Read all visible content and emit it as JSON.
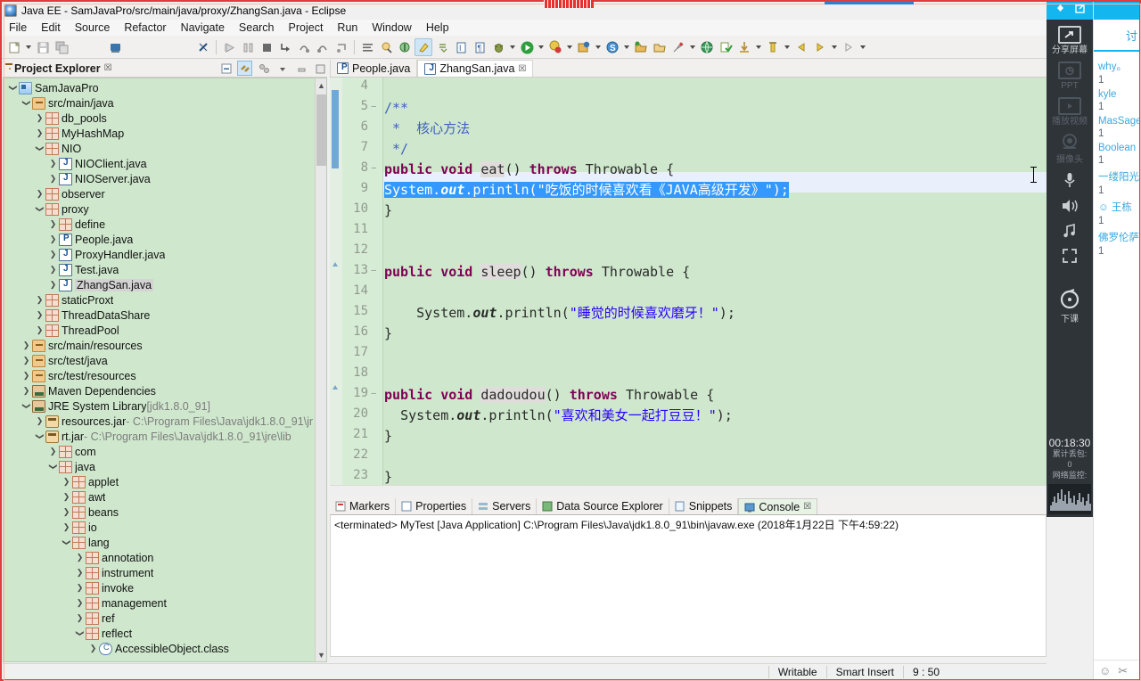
{
  "window": {
    "title": "Java EE - SamJavaPro/src/main/java/proxy/ZhangSan.java - Eclipse",
    "app_icon": "eclipse-icon"
  },
  "menubar": {
    "items": [
      "File",
      "Edit",
      "Source",
      "Refactor",
      "Navigate",
      "Search",
      "Project",
      "Run",
      "Window",
      "Help"
    ]
  },
  "toolbar": {
    "icons": [
      "new-icon",
      "save-icon",
      "save-all-icon",
      "print-icon",
      "link-break-icon",
      "resume-icon",
      "suspend-icon",
      "terminate-icon",
      "step-into-icon",
      "step-over-icon",
      "step-return-icon",
      "drop-to-frame-icon",
      "open-type-icon",
      "search-icon",
      "annotations-icon",
      "marker-icon",
      "next-annotation-icon",
      "prev-annotation-icon",
      "show-whitespace-icon",
      "pilcrow-icon",
      "debug-icon",
      "run-icon",
      "coverage-icon",
      "new-java-project-icon",
      "new-servlet-icon",
      "open-task-icon",
      "open-perspective-icon",
      "rocket-icon",
      "globe-icon",
      "validate-icon",
      "download-icon",
      "profile-icon",
      "back-icon",
      "forward-icon",
      "next-icon"
    ]
  },
  "project_explorer": {
    "title": "Project Explorer",
    "close_glyph": "☒",
    "header_icons": [
      "collapse-all-icon",
      "link-with-editor-icon",
      "view-menu-icon",
      "minimize-icon",
      "maximize-icon"
    ],
    "tree": [
      {
        "depth": 1,
        "arrow": "down",
        "icon": "project-icon",
        "label": "SamJavaPro",
        "sub": ""
      },
      {
        "depth": 2,
        "arrow": "down",
        "icon": "source-folder-icon",
        "label": "src/main/java",
        "sub": ""
      },
      {
        "depth": 3,
        "arrow": "right",
        "icon": "package-icon",
        "label": "db_pools",
        "sub": ""
      },
      {
        "depth": 3,
        "arrow": "right",
        "icon": "package-icon",
        "label": "MyHashMap",
        "sub": ""
      },
      {
        "depth": 3,
        "arrow": "down",
        "icon": "package-icon",
        "label": "NIO",
        "sub": ""
      },
      {
        "depth": 4,
        "arrow": "right",
        "icon": "java-file-icon",
        "label": "NIOClient.java",
        "sub": ""
      },
      {
        "depth": 4,
        "arrow": "right",
        "icon": "java-file-icon",
        "label": "NIOServer.java",
        "sub": ""
      },
      {
        "depth": 3,
        "arrow": "right",
        "icon": "package-icon",
        "label": "observer",
        "sub": ""
      },
      {
        "depth": 3,
        "arrow": "down",
        "icon": "package-icon",
        "label": "proxy",
        "sub": ""
      },
      {
        "depth": 4,
        "arrow": "right",
        "icon": "package-icon",
        "label": "define",
        "sub": ""
      },
      {
        "depth": 4,
        "arrow": "right",
        "icon": "java-interface-icon",
        "label": "People.java",
        "sub": ""
      },
      {
        "depth": 4,
        "arrow": "right",
        "icon": "java-file-icon",
        "label": "ProxyHandler.java",
        "sub": ""
      },
      {
        "depth": 4,
        "arrow": "right",
        "icon": "java-file-icon",
        "label": "Test.java",
        "sub": ""
      },
      {
        "depth": 4,
        "arrow": "right",
        "icon": "java-file-icon",
        "label": "ZhangSan.java",
        "sub": "",
        "selected": true
      },
      {
        "depth": 3,
        "arrow": "right",
        "icon": "package-icon",
        "label": "staticProxt",
        "sub": ""
      },
      {
        "depth": 3,
        "arrow": "right",
        "icon": "package-icon",
        "label": "ThreadDataShare",
        "sub": ""
      },
      {
        "depth": 3,
        "arrow": "right",
        "icon": "package-icon",
        "label": "ThreadPool",
        "sub": ""
      },
      {
        "depth": 2,
        "arrow": "right",
        "icon": "source-folder-icon",
        "label": "src/main/resources",
        "sub": ""
      },
      {
        "depth": 2,
        "arrow": "right",
        "icon": "source-folder-icon",
        "label": "src/test/java",
        "sub": ""
      },
      {
        "depth": 2,
        "arrow": "right",
        "icon": "source-folder-icon",
        "label": "src/test/resources",
        "sub": ""
      },
      {
        "depth": 2,
        "arrow": "right",
        "icon": "library-icon",
        "label": "Maven Dependencies",
        "sub": ""
      },
      {
        "depth": 2,
        "arrow": "down",
        "icon": "library-icon",
        "label": "JRE System Library",
        "sub": "[jdk1.8.0_91]"
      },
      {
        "depth": 3,
        "arrow": "right",
        "icon": "jar-icon",
        "label": "resources.jar",
        "sub": "- C:\\Program Files\\Java\\jdk1.8.0_91\\jr"
      },
      {
        "depth": 3,
        "arrow": "down",
        "icon": "jar-icon",
        "label": "rt.jar",
        "sub": "- C:\\Program Files\\Java\\jdk1.8.0_91\\jre\\lib"
      },
      {
        "depth": 4,
        "arrow": "right",
        "icon": "package-icon",
        "label": "com",
        "sub": ""
      },
      {
        "depth": 4,
        "arrow": "down",
        "icon": "package-icon",
        "label": "java",
        "sub": ""
      },
      {
        "depth": 5,
        "arrow": "right",
        "icon": "package-icon",
        "label": "applet",
        "sub": ""
      },
      {
        "depth": 5,
        "arrow": "right",
        "icon": "package-icon",
        "label": "awt",
        "sub": ""
      },
      {
        "depth": 5,
        "arrow": "right",
        "icon": "package-icon",
        "label": "beans",
        "sub": ""
      },
      {
        "depth": 5,
        "arrow": "right",
        "icon": "package-icon",
        "label": "io",
        "sub": ""
      },
      {
        "depth": 5,
        "arrow": "down",
        "icon": "package-icon",
        "label": "lang",
        "sub": ""
      },
      {
        "depth": 6,
        "arrow": "right",
        "icon": "package-icon",
        "label": "annotation",
        "sub": ""
      },
      {
        "depth": 6,
        "arrow": "right",
        "icon": "package-icon",
        "label": "instrument",
        "sub": ""
      },
      {
        "depth": 6,
        "arrow": "right",
        "icon": "package-icon",
        "label": "invoke",
        "sub": ""
      },
      {
        "depth": 6,
        "arrow": "right",
        "icon": "package-icon",
        "label": "management",
        "sub": ""
      },
      {
        "depth": 6,
        "arrow": "right",
        "icon": "package-icon",
        "label": "ref",
        "sub": ""
      },
      {
        "depth": 6,
        "arrow": "down",
        "icon": "package-icon",
        "label": "reflect",
        "sub": ""
      },
      {
        "depth": 7,
        "arrow": "right",
        "icon": "class-file-icon",
        "label": "AccessibleObject.class",
        "sub": ""
      }
    ]
  },
  "editor": {
    "tabs": [
      {
        "label": "People.java",
        "icon": "java-interface-icon",
        "active": false,
        "closable": false
      },
      {
        "label": "ZhangSan.java",
        "icon": "java-file-icon",
        "active": true,
        "closable": true,
        "close_glyph": "☒"
      }
    ],
    "lines": [
      {
        "num": "4",
        "fold": false,
        "marker": "",
        "text": ""
      },
      {
        "num": "5",
        "fold": true,
        "marker": "",
        "text": "    /**"
      },
      {
        "num": "6",
        "fold": false,
        "marker": "",
        "text": "     *  核心方法"
      },
      {
        "num": "7",
        "fold": false,
        "marker": "",
        "text": "     */"
      },
      {
        "num": "8",
        "fold": true,
        "marker": "tri",
        "text": "    public void eat() throws Throwable {"
      },
      {
        "num": "9",
        "fold": false,
        "marker": "",
        "text": "        System.out.println(\"吃饭的时候喜欢看《JAVA高级开发》\");",
        "highlighted": true,
        "selected": true
      },
      {
        "num": "10",
        "fold": false,
        "marker": "",
        "text": "    }"
      },
      {
        "num": "11",
        "fold": false,
        "marker": "",
        "text": ""
      },
      {
        "num": "12",
        "fold": false,
        "marker": "",
        "text": ""
      },
      {
        "num": "13",
        "fold": true,
        "marker": "tri",
        "text": "    public void sleep() throws Throwable {"
      },
      {
        "num": "14",
        "fold": false,
        "marker": "",
        "text": ""
      },
      {
        "num": "15",
        "fold": false,
        "marker": "",
        "text": "        System.out.println(\"睡觉的时候喜欢磨牙！\");"
      },
      {
        "num": "16",
        "fold": false,
        "marker": "",
        "text": "    }"
      },
      {
        "num": "17",
        "fold": false,
        "marker": "",
        "text": ""
      },
      {
        "num": "18",
        "fold": false,
        "marker": "",
        "text": ""
      },
      {
        "num": "19",
        "fold": true,
        "marker": "tri",
        "text": "    public void dadoudou() throws Throwable {"
      },
      {
        "num": "20",
        "fold": false,
        "marker": "",
        "text": "       System.out.println(\"喜欢和美女一起打豆豆！\");"
      },
      {
        "num": "21",
        "fold": false,
        "marker": "",
        "text": "    }"
      },
      {
        "num": "22",
        "fold": false,
        "marker": "",
        "text": ""
      },
      {
        "num": "23",
        "fold": false,
        "marker": "",
        "text": "}"
      }
    ],
    "tokens": {
      "kw_public": "public",
      "kw_void": "void",
      "kw_throws": "throws",
      "type_throwable": "Throwable",
      "m_eat": "eat",
      "m_sleep": "sleep",
      "m_dadoudou": "dadoudou",
      "sysout": "System.",
      "out": "out",
      "println": ".println(",
      "str_eat": "\"吃饭的时候喜欢看《JAVA高级开发》\"",
      "str_sleep": "\"睡觉的时候喜欢磨牙！\"",
      "str_dadoudou": "\"喜欢和美女一起打豆豆！\"",
      "comment_open": "/**",
      "comment_mid": " *  核心方法",
      "comment_close": " */",
      "brace_close": "}"
    }
  },
  "bottom_panel": {
    "tabs": [
      {
        "label": "Markers",
        "icon": "markers-icon",
        "active": false
      },
      {
        "label": "Properties",
        "icon": "properties-icon",
        "active": false
      },
      {
        "label": "Servers",
        "icon": "servers-icon",
        "active": false
      },
      {
        "label": "Data Source Explorer",
        "icon": "data-source-icon",
        "active": false
      },
      {
        "label": "Snippets",
        "icon": "snippets-icon",
        "active": false
      },
      {
        "label": "Console",
        "icon": "console-icon",
        "active": true,
        "close_glyph": "☒"
      }
    ],
    "console_line": "<terminated> MyTest [Java Application] C:\\Program Files\\Java\\jdk1.8.0_91\\bin\\javaw.exe (2018年1月22日 下午4:59:22)"
  },
  "statusbar": {
    "writable": "Writable",
    "insert_mode": "Smart Insert",
    "cursor_position": "9 : 50"
  },
  "dock": {
    "top_icons": [
      "pin-icon",
      "popout-icon"
    ],
    "buttons": [
      {
        "label": "分享屏幕",
        "icon": "share-screen-icon",
        "dim": false,
        "boxed": true
      },
      {
        "label": "PPT",
        "icon": "ppt-icon",
        "dim": true,
        "boxed": true
      },
      {
        "label": "播放视频",
        "icon": "play-video-icon",
        "dim": true,
        "boxed": true
      },
      {
        "label": "摄像头",
        "icon": "camera-icon",
        "dim": true,
        "boxed": false
      },
      {
        "label": "",
        "icon": "microphone-icon",
        "dim": false,
        "boxed": false
      },
      {
        "label": "",
        "icon": "speaker-icon",
        "dim": false,
        "boxed": false
      },
      {
        "label": "",
        "icon": "music-icon",
        "dim": false,
        "boxed": false
      },
      {
        "label": "",
        "icon": "fullscreen-icon",
        "dim": false,
        "boxed": false
      },
      {
        "label": "下课",
        "icon": "end-class-icon",
        "dim": false,
        "boxed": false
      }
    ],
    "timer": "00:18:30",
    "packet_loss_label": "累计丢包:",
    "packet_loss_value": "0",
    "network_label": "网络监控:"
  },
  "chat": {
    "title": "讨",
    "messages": [
      {
        "user": "why。",
        "text": "1"
      },
      {
        "user": "kyle",
        "text": "1"
      },
      {
        "user": "MasSage",
        "text": "1"
      },
      {
        "user": "Boolean",
        "text": "1"
      },
      {
        "user": "一缕阳光",
        "text": "1"
      },
      {
        "user": "王栋",
        "text": "1",
        "icon": "badge-icon"
      },
      {
        "user": "佛罗伦萨",
        "text": "1"
      }
    ],
    "footer_icons": [
      "emoji-icon",
      "scissors-icon"
    ],
    "emoji_glyph": "☺",
    "scissors_glyph": "✂"
  },
  "colors": {
    "editor_bg": "#cfe8cd",
    "gutter_bg": "#d7ecd5",
    "tree_bg": "#cfe8cd",
    "selection": "#3399ff",
    "highlight_line": "#eaf0fb",
    "keyword": "#7f0055",
    "string": "#2a00ff",
    "comment": "#3f5fbf",
    "dock_bg": "#2f3439",
    "accent_blue": "#14b6f0",
    "rec_border": "#e23b3b"
  }
}
